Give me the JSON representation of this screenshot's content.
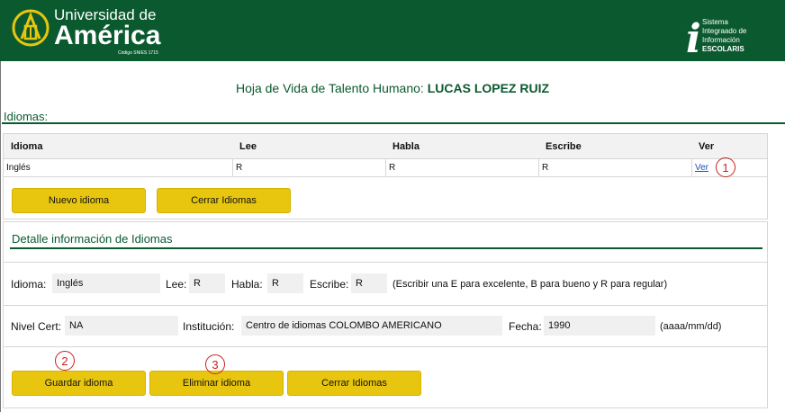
{
  "header": {
    "university_line1": "Universidad de",
    "university_line2": "América",
    "university_code": "Código SNIES 1715",
    "system_line1": "Sistema",
    "system_line2": "Integraado de",
    "system_line3": "Información",
    "system_line4": "ESCOLARIS",
    "system_icon": "i"
  },
  "page": {
    "title_prefix": "Hoja de Vida de Talento Humano:",
    "person_name": "LUCAS LOPEZ RUIZ"
  },
  "section": {
    "label": "Idiomas:"
  },
  "table": {
    "headers": [
      "Idioma",
      "Lee",
      "Habla",
      "Escribe",
      "Ver"
    ],
    "rows": [
      {
        "idioma": "Inglés",
        "lee": "R",
        "habla": "R",
        "escribe": "R",
        "ver": "Ver"
      }
    ]
  },
  "list_buttons": {
    "nuevo": "Nuevo idioma",
    "cerrar": "Cerrar Idiomas"
  },
  "detail": {
    "title": "Detalle información de Idiomas",
    "idioma_label": "Idioma:",
    "idioma_value": "Inglés",
    "lee_label": "Lee:",
    "lee_value": "R",
    "habla_label": "Habla:",
    "habla_value": "R",
    "escribe_label": "Escribe:",
    "escribe_value": "R",
    "scale_hint": "(Escribir una E para excelente, B para bueno y R para regular)",
    "nivel_label": "Nivel Cert:",
    "nivel_value": "NA",
    "institucion_label": "Institución:",
    "institucion_value": "Centro de idiomas COLOMBO AMERICANO",
    "fecha_label": "Fecha:",
    "fecha_value": "1990",
    "fecha_hint": "(aaaa/mm/dd)"
  },
  "detail_buttons": {
    "guardar": "Guardar idioma",
    "eliminar": "Eliminar idioma",
    "cerrar": "Cerrar Idiomas"
  },
  "callouts": {
    "c1": "1",
    "c2": "2",
    "c3": "3"
  },
  "colors": {
    "brand_green": "#0b5a2f",
    "button_yellow": "#e8c60f",
    "callout_red": "#cc1f1f",
    "link_blue": "#1a4fb4"
  }
}
